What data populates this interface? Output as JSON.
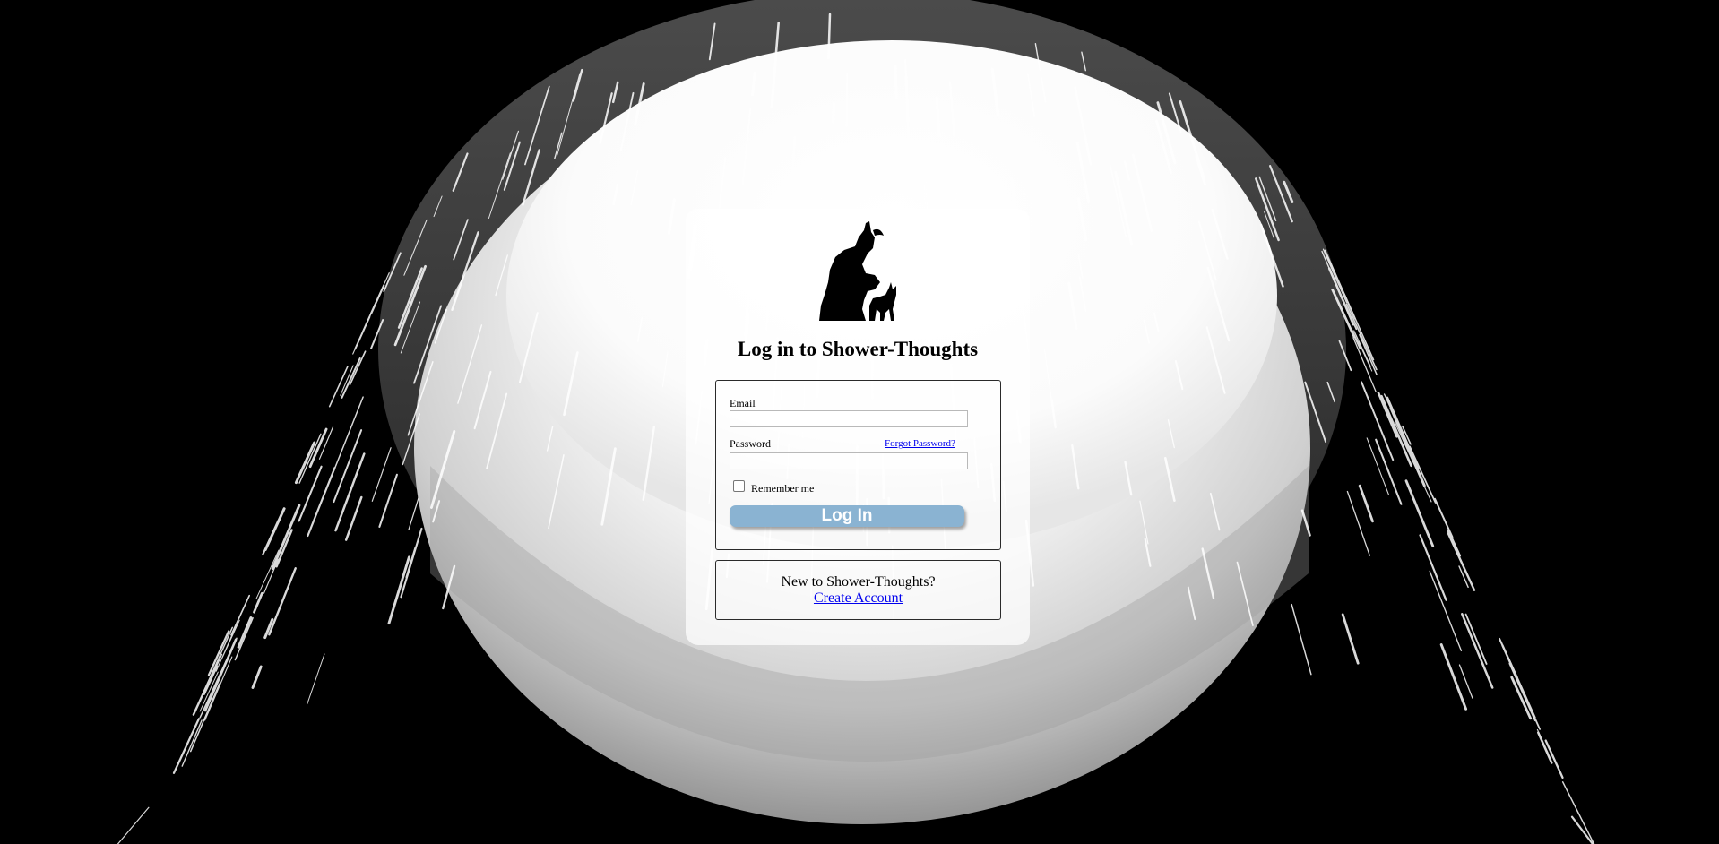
{
  "background": {
    "image": "shower-head-water-icon",
    "base_color": "#000000"
  },
  "logo": {
    "icon": "thinker-with-dog-icon"
  },
  "title": "Log in to Shower-Thoughts",
  "login_form": {
    "email_label": "Email",
    "email_value": "",
    "password_label": "Password",
    "password_value": "",
    "forgot_password": "Forgot Password?",
    "remember_label": "Remember me",
    "remember_checked": false,
    "submit_label": "Log In",
    "submit_color": "#8ab3d2"
  },
  "signup": {
    "prompt": "New to Shower-Thoughts?",
    "link": "Create Account"
  },
  "colors": {
    "link": "#0000ee"
  }
}
